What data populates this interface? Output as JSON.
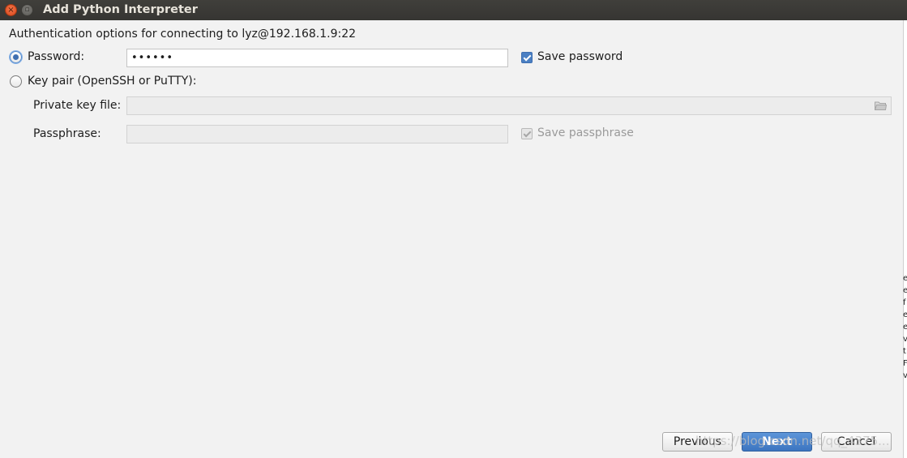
{
  "window": {
    "title": "Add Python Interpreter",
    "close_glyph": "×",
    "minimize_glyph": "▫"
  },
  "caption": "Authentication options for connecting to lyz@192.168.1.9:22",
  "auth": {
    "password_option_label": "Password:",
    "password_selected": true,
    "password_value": "••••••",
    "save_password_label": "Save password",
    "save_password_checked": true,
    "keypair_option_label": "Key pair (OpenSSH or PuTTY):",
    "keypair_selected": false,
    "private_key_label": "Private key file:",
    "private_key_value": "",
    "passphrase_label": "Passphrase:",
    "passphrase_value": "",
    "save_passphrase_label": "Save passphrase",
    "save_passphrase_checked": true
  },
  "buttons": {
    "previous": "Previous",
    "next": "Next",
    "cancel": "Cancel"
  },
  "watermark": "https://blog.csdn.net/qq_4375...",
  "edge_glyphs": [
    "e",
    "e",
    "f",
    "e",
    "e",
    "v",
    "t",
    "F",
    "v"
  ],
  "colors": {
    "accent": "#4a7fc3",
    "titlebar": "#3b3a36",
    "close": "#e9572b"
  }
}
